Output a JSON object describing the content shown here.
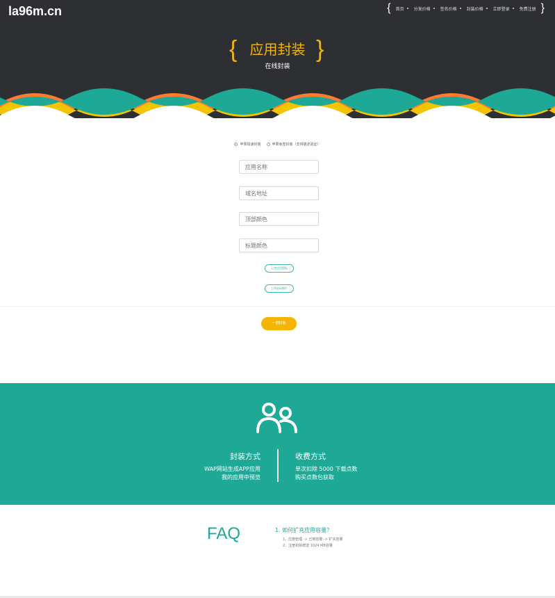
{
  "brand": {
    "logo": "la96m.cn"
  },
  "nav": {
    "items": [
      {
        "label": "首页"
      },
      {
        "label": "分发价格"
      },
      {
        "label": "签名价格"
      },
      {
        "label": "封装价格"
      },
      {
        "label": "立即登录"
      },
      {
        "label": "免费注册"
      }
    ]
  },
  "hero": {
    "title": "应用封装",
    "subtitle": "在线封装",
    "brace_left": "{",
    "brace_right": "}"
  },
  "form": {
    "mode_options": [
      {
        "label": "苹果极速封装",
        "checked": true
      },
      {
        "label": "苹果免签封装（支持描述验证）",
        "checked": false
      }
    ],
    "app_name_placeholder": "应用名称",
    "domain_placeholder": "域名地址",
    "top_color_placeholder": "顶部颜色",
    "title_color_placeholder": "标题颜色",
    "upload_icon_label": "上传应用图标",
    "upload_splash_label": "上传启动图片",
    "submit_label": "一键封装"
  },
  "info": {
    "left_title": "封装方式",
    "left_lines": [
      "WAP网站生成APP应用",
      "我的应用中预览"
    ],
    "right_title": "收费方式",
    "right_lines": [
      "单次扣除 5000 下载点数",
      "购买点数包获取"
    ]
  },
  "faq": {
    "title": "FAQ",
    "question": "1. 如何扩充应用容量？",
    "answers": [
      "1、应用管理 -> 已用容量 -> 扩充容量",
      "2、注册扣除赠送 1024 MB容量"
    ]
  },
  "colors": {
    "header_bg": "#2d2f33",
    "accent_yellow": "#f4b400",
    "teal": "#1ea896",
    "wave_orange": "#ff7b2e",
    "wave_yellow": "#f4c400"
  },
  "icons": {
    "users": "users-icon"
  }
}
